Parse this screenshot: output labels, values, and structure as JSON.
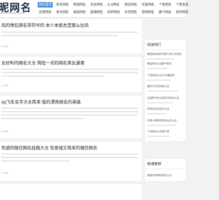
{
  "header": {
    "logo": "昵网名",
    "url": "www.leziwangming.com",
    "nav": [
      {
        "label": "网名首页",
        "active": true
      },
      {
        "label": "男生网名",
        "active": false
      },
      {
        "label": "情侣网名",
        "active": false
      },
      {
        "label": "女生网名",
        "active": false
      },
      {
        "label": "Q Q网名",
        "active": false
      },
      {
        "label": "微信网名",
        "active": false
      },
      {
        "label": "可爱网名",
        "active": false
      },
      {
        "label": "个性网名",
        "active": false
      },
      {
        "label": "个性签名",
        "active": false
      },
      {
        "label": "伤感网名",
        "active": false
      },
      {
        "label": "英文网名",
        "active": false
      },
      {
        "label": "唯美网名",
        "active": false
      },
      {
        "label": "超拽网名",
        "active": false
      },
      {
        "label": "好听网名",
        "active": false
      },
      {
        "label": "抖音网名",
        "active": false
      },
      {
        "label": "游戏网名",
        "active": false
      },
      {
        "label": "霸气网名",
        "active": false
      },
      {
        "label": "搞笑网名",
        "active": false
      }
    ]
  },
  "articles": [
    {
      "title": "风的情侣网名带符号的 本少本姐总是那么拉风",
      "meta": "© 9/08"
    },
    {
      "title": "女好听的网名大全 简短一点的网名男女通用",
      "meta": "© 9/08"
    },
    {
      "title": "qq飞车名字大全简单 我的漂亮网名的英雄.",
      "meta": "© 9/08"
    },
    {
      "title": "伤感的微信网名经典大全 有意境又简单的微信网名",
      "meta": "© 9/08"
    }
  ],
  "sidebar": {
    "hot_title": "阅读排行",
    "hot_items": [
      "情侣网名带符号两个男士的网名",
      "情侣网名大全霸气阳光",
      "个性网名女生2025最新的",
      "福字开头的网名大全",
      "比较霸气的女孩名字网名大全",
      "好听的女孩名字大全",
      "可爱小清新的网名女生大全",
      "个性网名大全霸气男"
    ],
    "new_title": "微博推荐",
    "new_items": [
      "超级好听情侣网名大全"
    ]
  }
}
